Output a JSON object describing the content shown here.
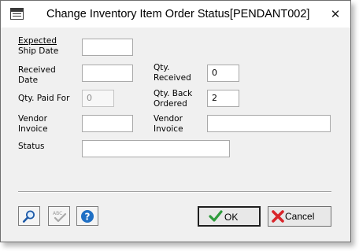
{
  "window": {
    "title": "Change Inventory Item Order Status[PENDANT002]",
    "close_glyph": "✕"
  },
  "form": {
    "expected_ship_date": {
      "label_line1": "Expected",
      "label_line2": "Ship Date",
      "value": ""
    },
    "received_date": {
      "label_line1": "Received",
      "label_line2": "Date",
      "value": ""
    },
    "qty_paid_for": {
      "label": "Qty. Paid For",
      "value": "0"
    },
    "vendor_invoice_left": {
      "label_line1": "Vendor",
      "label_line2": "Invoice",
      "value": ""
    },
    "qty_received": {
      "label_line1": "Qty.",
      "label_line2": "Received",
      "value": "0"
    },
    "qty_back_ordered": {
      "label_line1": "Qty. Back",
      "label_line2": "Ordered",
      "value": "2"
    },
    "vendor_invoice_right": {
      "label_line1": "Vendor",
      "label_line2": "Invoice",
      "value": ""
    },
    "status": {
      "label": "Status",
      "value": ""
    }
  },
  "footer": {
    "icons": [
      "magnifier-icon",
      "spellcheck-icon",
      "help-icon"
    ],
    "ok_label": "OK",
    "cancel_label": "Cancel",
    "colors": {
      "ok_check": "#2e9b3c",
      "cancel_x": "#d9252a",
      "help_blue": "#1f6fc4"
    }
  }
}
